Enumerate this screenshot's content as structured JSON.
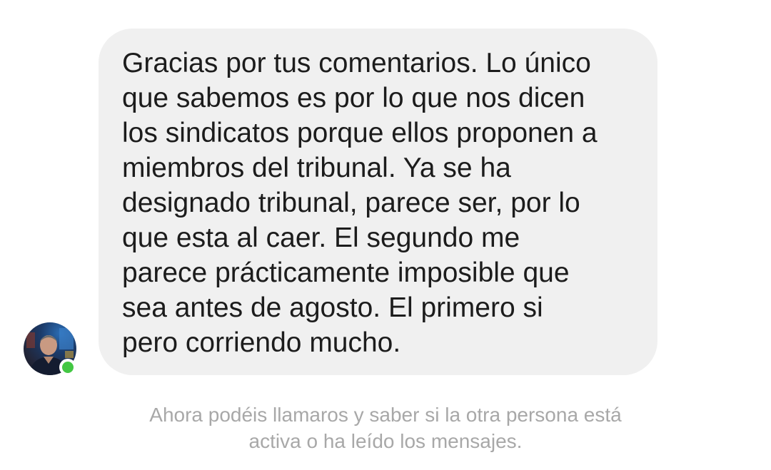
{
  "conversation": {
    "messages": [
      {
        "direction": "incoming",
        "text": "Gracias por tus comentarios. Lo único\nque sabemos es por lo que nos dicen\nlos sindicatos porque ellos proponen a\nmiembros del tribunal. Ya se ha\ndesignado tribunal, parece ser, por lo\nque esta al caer. El segundo me\nparece prácticamente imposible que\nsea antes de agosto. El primero si\npero corriendo mucho."
      }
    ],
    "sender": {
      "avatar_icon": "user-avatar-photo",
      "online": true,
      "presence_color": "#43c743"
    }
  },
  "notice": {
    "text": "Ahora podéis llamaros y saber si la otra persona está\nactiva o ha leído los mensajes."
  },
  "colors": {
    "background": "#ffffff",
    "bubble": "#f0f0f0",
    "message_text": "#1c1c1c",
    "notice_text": "#a8a8a8"
  }
}
